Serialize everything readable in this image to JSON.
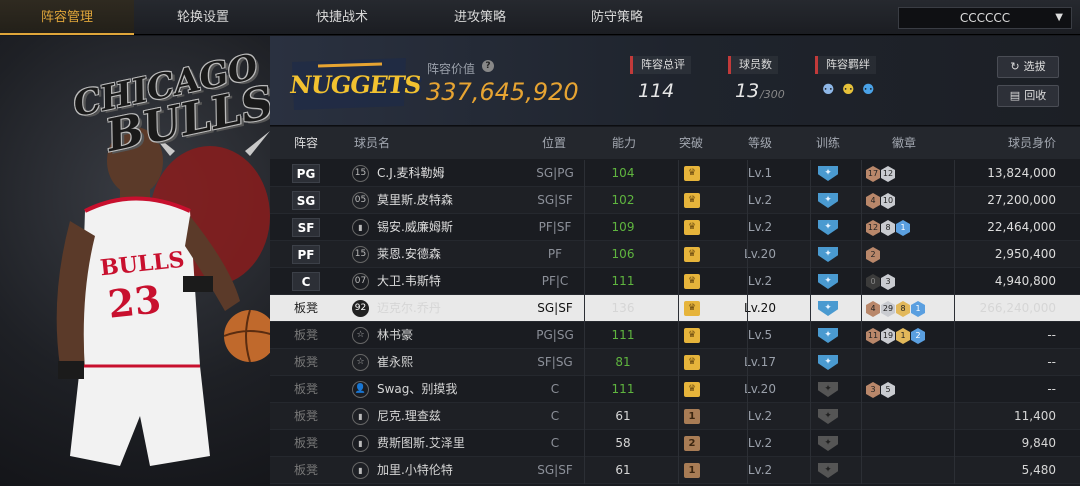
{
  "tabs": [
    "阵容管理",
    "轮换设置",
    "快捷战术",
    "进攻策略",
    "防守策略"
  ],
  "team_select": {
    "value": "CCCCCC"
  },
  "hero": {
    "city": "CHICAGO",
    "name": "BULLS",
    "jersey_text": "BULLS",
    "jersey_number": "23"
  },
  "summary": {
    "team_logo_text": "NUGGETS",
    "value_label": "阵容价值",
    "value": "337,645,920",
    "overall_label": "阵容总评",
    "overall": "114",
    "count_label": "球员数",
    "count": "13",
    "count_max": "/300",
    "chem_label": "阵容羁绊",
    "btn_select": "选拔",
    "btn_return": "回收"
  },
  "columns": [
    "阵容",
    "球员名",
    "位置",
    "能力",
    "突破",
    "等级",
    "训练",
    "徽章",
    "球员身价"
  ],
  "rows": [
    {
      "slot": "PG",
      "starter": true,
      "num": "15",
      "name": "C.J.麦科勒姆",
      "pos": "SG|PG",
      "ability": "104",
      "ability_green": true,
      "break": "gold",
      "level": "Lv.1",
      "train": "blue",
      "badges": [
        [
          "17",
          "bronze"
        ],
        [
          "12",
          "silver"
        ]
      ],
      "price": "13,824,000"
    },
    {
      "slot": "SG",
      "starter": true,
      "num": "05",
      "name": "莫里斯.皮特森",
      "pos": "SG|SF",
      "ability": "102",
      "ability_green": true,
      "break": "gold",
      "level": "Lv.2",
      "train": "blue",
      "badges": [
        [
          "4",
          "bronze"
        ],
        [
          "10",
          "silver"
        ]
      ],
      "price": "27,200,000"
    },
    {
      "slot": "SF",
      "starter": true,
      "num": "bars",
      "name": "锡安.威廉姆斯",
      "pos": "PF|SF",
      "ability": "109",
      "ability_green": true,
      "break": "gold",
      "level": "Lv.2",
      "train": "blue",
      "badges": [
        [
          "12",
          "bronze"
        ],
        [
          "8",
          "silver"
        ],
        [
          "1",
          "blue"
        ]
      ],
      "price": "22,464,000"
    },
    {
      "slot": "PF",
      "starter": true,
      "num": "15",
      "name": "莱恩.安德森",
      "pos": "PF",
      "ability": "106",
      "ability_green": true,
      "break": "gold",
      "level": "Lv.20",
      "train": "blue",
      "badges": [
        [
          "2",
          "bronze"
        ]
      ],
      "price": "2,950,400"
    },
    {
      "slot": "C",
      "starter": true,
      "num": "07",
      "name": "大卫.韦斯特",
      "pos": "PF|C",
      "ability": "111",
      "ability_green": true,
      "break": "gold",
      "level": "Lv.2",
      "train": "blue",
      "badges": [
        [
          "0",
          "dark"
        ],
        [
          "3",
          "silver"
        ]
      ],
      "price": "4,940,800"
    },
    {
      "slot": "板凳",
      "starter": false,
      "selected": true,
      "num": "92",
      "name": "迈克尔.乔丹",
      "pos": "SG|SF",
      "ability": "136",
      "ability_green": false,
      "break": "gold",
      "level": "Lv.20",
      "train": "blue",
      "badges": [
        [
          "4",
          "bronze"
        ],
        [
          "29",
          "silver"
        ],
        [
          "8",
          "gold"
        ],
        [
          "1",
          "blue"
        ]
      ],
      "price": "266,240,000"
    },
    {
      "slot": "板凳",
      "starter": false,
      "num": "star",
      "name": "林书豪",
      "pos": "PG|SG",
      "ability": "111",
      "ability_green": true,
      "break": "gold",
      "level": "Lv.5",
      "train": "blue",
      "badges": [
        [
          "11",
          "bronze"
        ],
        [
          "19",
          "silver"
        ],
        [
          "1",
          "gold"
        ],
        [
          "2",
          "blue"
        ]
      ],
      "price": "--"
    },
    {
      "slot": "板凳",
      "starter": false,
      "num": "star",
      "name": "崔永熙",
      "pos": "SF|SG",
      "ability": "81",
      "ability_green": true,
      "break": "gold",
      "level": "Lv.17",
      "train": "blue",
      "badges": [],
      "price": "--"
    },
    {
      "slot": "板凳",
      "starter": false,
      "num": "person",
      "name": "Swag、别摸我",
      "pos": "C",
      "ability": "111",
      "ability_green": true,
      "break": "gold",
      "level": "Lv.20",
      "train": "grey",
      "badges": [
        [
          "3",
          "bronze"
        ],
        [
          "5",
          "silver"
        ]
      ],
      "price": "--"
    },
    {
      "slot": "板凳",
      "starter": false,
      "num": "bars",
      "name": "尼克.理查兹",
      "pos": "C",
      "ability": "61",
      "ability_green": false,
      "break": "1",
      "level": "Lv.2",
      "train": "grey",
      "badges": [],
      "price": "11,400"
    },
    {
      "slot": "板凳",
      "starter": false,
      "num": "bars",
      "name": "费斯图斯.艾泽里",
      "pos": "C",
      "ability": "58",
      "ability_green": false,
      "break": "2",
      "level": "Lv.2",
      "train": "grey",
      "badges": [],
      "price": "9,840"
    },
    {
      "slot": "板凳",
      "starter": false,
      "num": "bars",
      "name": "加里.小特伦特",
      "pos": "SG|SF",
      "ability": "61",
      "ability_green": false,
      "break": "1",
      "level": "Lv.2",
      "train": "grey",
      "badges": [],
      "price": "5,480"
    }
  ],
  "colors": {
    "accent": "#e0a63a",
    "green": "#5fb53f",
    "red": "#c23a3a",
    "train_blue": "#4a9ad0"
  }
}
